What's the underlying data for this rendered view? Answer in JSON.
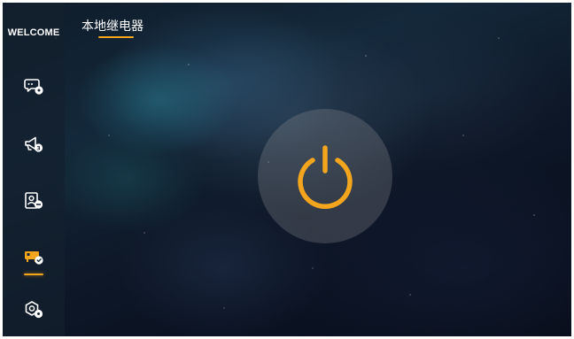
{
  "sidebar": {
    "brand": "WELCOME",
    "items": [
      {
        "name": "chat-settings",
        "icon": "chat-bubble-gear-icon",
        "active": false
      },
      {
        "name": "broadcast",
        "icon": "megaphone-icon",
        "active": false
      },
      {
        "name": "access-control",
        "icon": "id-card-icon",
        "active": false
      },
      {
        "name": "relay",
        "icon": "relay-switch-icon",
        "active": true
      },
      {
        "name": "settings",
        "icon": "hexagon-gear-icon",
        "active": false
      }
    ]
  },
  "header": {
    "title": "本地继电器"
  },
  "main": {
    "power_button": {
      "icon": "power-icon",
      "state": "off"
    }
  },
  "colors": {
    "accent": "#f2a51d",
    "icon": "#ffffff",
    "sidebar_bg": "#14202e",
    "button_bg": "#96969b"
  }
}
